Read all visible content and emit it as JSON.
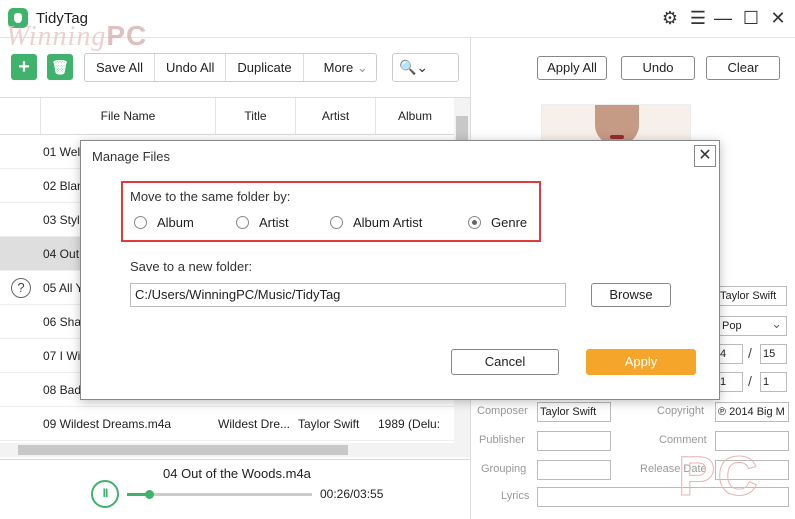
{
  "app": {
    "title": "TidyTag",
    "accent": "#3fb36b",
    "apply_color": "#f5a52a"
  },
  "watermark": {
    "main": "Winning",
    "suffix": "PC",
    "corner": "PC"
  },
  "window_controls": [
    {
      "name": "gear-icon",
      "glyph": "⚙"
    },
    {
      "name": "menu-icon",
      "glyph": "☰"
    },
    {
      "name": "minimize-icon",
      "glyph": "—"
    },
    {
      "name": "maximize-icon",
      "glyph": "☐"
    },
    {
      "name": "close-icon",
      "glyph": "✕"
    }
  ],
  "toolbar": {
    "add_glyph": "+",
    "delete_glyph": "🗑",
    "save_all": "Save All",
    "undo_all": "Undo All",
    "duplicate": "Duplicate",
    "more": "More",
    "more_chevron": "⌄",
    "search_glyph": "🔍⌄"
  },
  "table": {
    "headers": {
      "file_name": "File Name",
      "title": "Title",
      "artist": "Artist",
      "album": "Album"
    },
    "rows": [
      {
        "file": "01 Welc",
        "title": "",
        "artist": "",
        "album": ""
      },
      {
        "file": "02 Blan",
        "title": "",
        "artist": "",
        "album": ""
      },
      {
        "file": "03 Style",
        "title": "",
        "artist": "",
        "album": ""
      },
      {
        "file": "04 Out",
        "title": "",
        "artist": "",
        "album": ""
      },
      {
        "file": "05 All Y",
        "title": "",
        "artist": "",
        "album": ""
      },
      {
        "file": "06 Shak",
        "title": "",
        "artist": "",
        "album": ""
      },
      {
        "file": "07 I Wis",
        "title": "",
        "artist": "",
        "album": ""
      },
      {
        "file": "08 Bad",
        "title": "",
        "artist": "",
        "album": ""
      },
      {
        "file": "09 Wildest Dreams.m4a",
        "title": "Wildest Dre...",
        "artist": "Taylor Swift",
        "album": "1989 (Delu:"
      }
    ],
    "selected_index": 3,
    "help_glyph": "?"
  },
  "player": {
    "now_playing": "04 Out of the Woods.m4a",
    "pause_glyph": "II",
    "progress": 0.12,
    "time": "00:26/03:55"
  },
  "right_panel": {
    "apply_all": "Apply All",
    "undo": "Undo",
    "clear": "Clear",
    "artist_value": "Taylor Swift",
    "genre_value": "Pop",
    "genre_chevron": "⌄",
    "track_no": "4",
    "track_total": "15",
    "disc_no": "1",
    "disc_total": "1",
    "slash": "/",
    "composer_label": "Composer",
    "composer_value": "Taylor Swift",
    "copyright_label": "Copyright",
    "copyright_value": "℗ 2014 Big M",
    "publisher_label": "Publisher",
    "comment_label": "Comment",
    "grouping_label": "Grouping",
    "release_date_label": "Release Date",
    "lyrics_label": "Lyrics"
  },
  "dialog": {
    "title": "Manage Files",
    "close_glyph": "✕",
    "move_label": "Move to the same folder by:",
    "options": [
      {
        "label": "Album",
        "selected": false
      },
      {
        "label": "Artist",
        "selected": false
      },
      {
        "label": "Album Artist",
        "selected": false
      },
      {
        "label": "Genre",
        "selected": true
      }
    ],
    "save_label": "Save to a new folder:",
    "path": "C:/Users/WinningPC/Music/TidyTag",
    "browse": "Browse",
    "cancel": "Cancel",
    "apply": "Apply"
  }
}
